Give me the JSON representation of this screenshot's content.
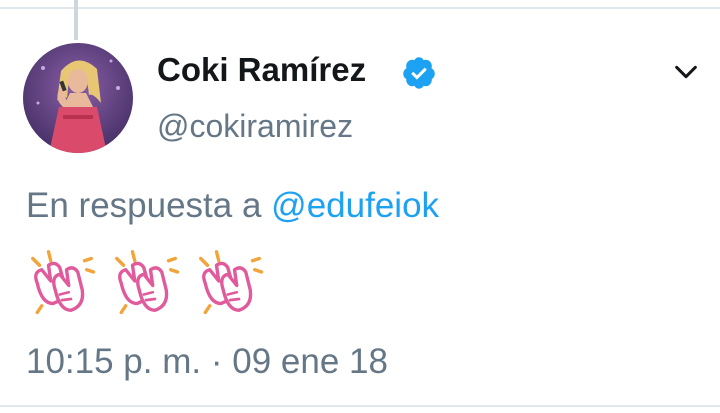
{
  "tweet": {
    "display_name": "Coki Ramírez",
    "handle": "@cokiramirez",
    "reply_prefix": "En respuesta a",
    "reply_handle": "@edufeiok",
    "emojis": [
      "clapping-hands-emoji",
      "clapping-hands-emoji",
      "clapping-hands-emoji"
    ],
    "time": "10:15 p. m.",
    "separator": "·",
    "date": "09 ene 18"
  },
  "icons": {
    "verified": "verified-badge-icon",
    "menu": "chevron-down-icon"
  },
  "colors": {
    "accent": "#1da1f2",
    "name": "#14171a",
    "secondary": "#657786",
    "emoji_pink": "#e05a9c",
    "emoji_orange": "#f2a33a"
  }
}
